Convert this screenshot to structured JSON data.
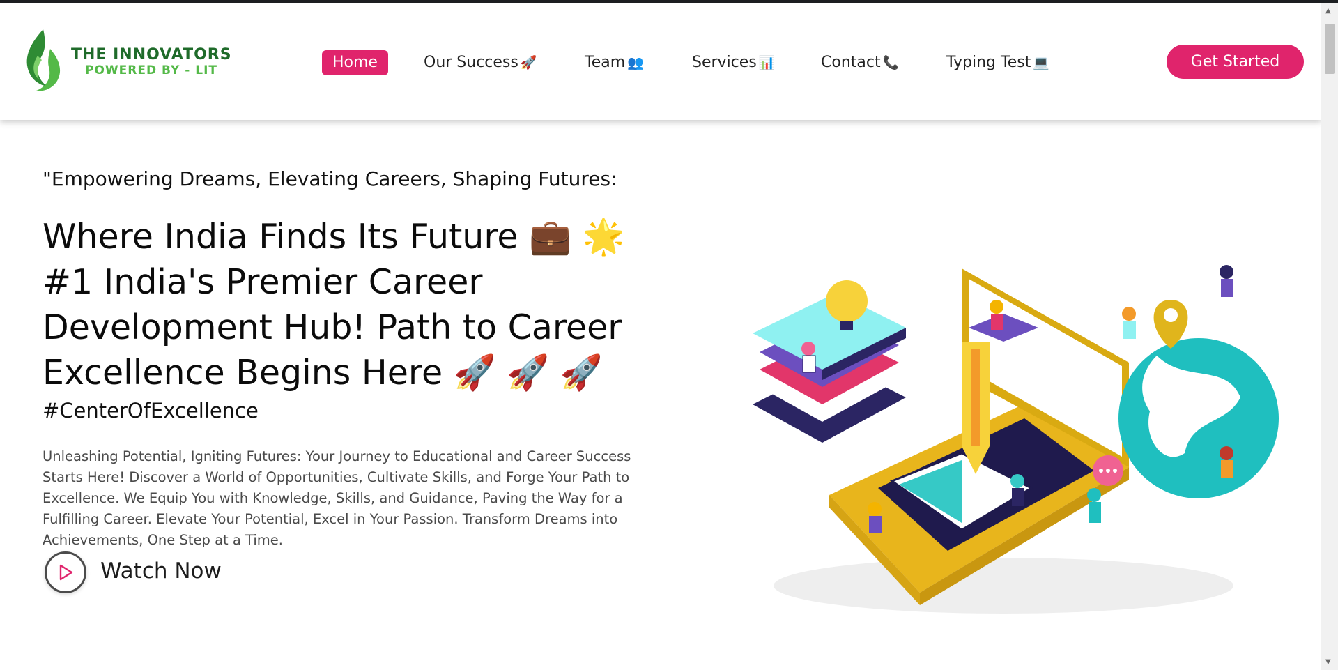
{
  "brand": {
    "name": "THE INNOVATORS",
    "tagline": "POWERED BY - LIT",
    "colors": {
      "dark_green": "#1f6b2a",
      "light_green": "#54b948",
      "accent": "#e0246c"
    }
  },
  "nav": {
    "items": [
      {
        "label": "Home",
        "emoji": "",
        "active": true
      },
      {
        "label": "Our Success",
        "emoji": "🚀",
        "active": false
      },
      {
        "label": "Team",
        "emoji": "👥",
        "active": false
      },
      {
        "label": "Services",
        "emoji": "📊",
        "active": false
      },
      {
        "label": "Contact",
        "emoji": "📞",
        "active": false
      },
      {
        "label": "Typing Test",
        "emoji": "💻",
        "active": false
      }
    ],
    "cta_label": "Get Started"
  },
  "hero": {
    "tagline": "\"Empowering Dreams, Elevating Careers, Shaping Futures:",
    "headline": "Where India Finds Its Future 💼 🌟 #1 India's Premier Career Development Hub! Path to Career Excellence Begins Here 🚀 🚀 🚀",
    "hashtag": "#CenterOfExcellence",
    "description": "Unleashing Potential, Igniting Futures: Your Journey to Educational and Career Success Starts Here! Discover a World of Opportunities, Cultivate Skills, and Forge Your Path to Excellence. We Equip You with Knowledge, Skills, and Guidance, Paving the Way for a Fulfilling Career. Elevate Your Potential, Excel in Your Passion. Transform Dreams into Achievements, One Step at a Time.",
    "watch_label": "Watch Now"
  },
  "icons": {
    "logo": "flame-logo-icon",
    "play": "play-icon",
    "illustration": "career-education-isometric-illustration"
  }
}
